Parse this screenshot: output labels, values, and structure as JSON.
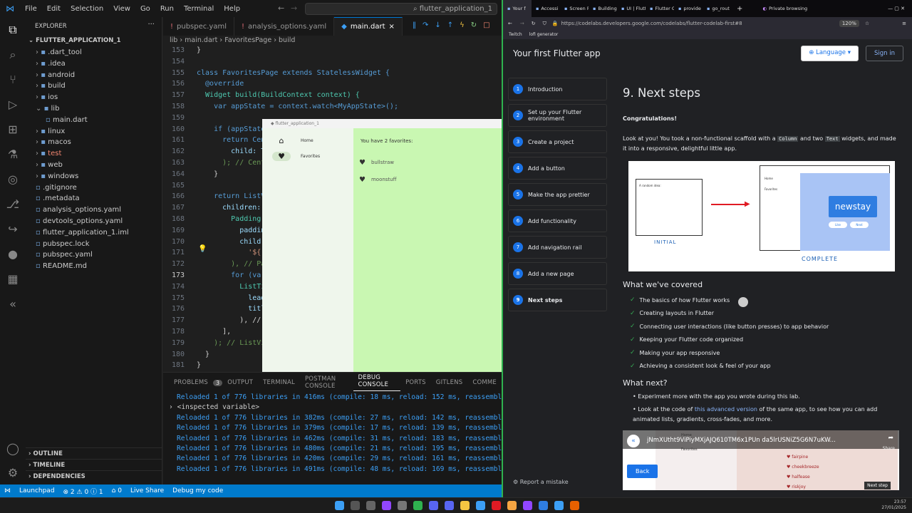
{
  "vscode": {
    "menu": [
      "File",
      "Edit",
      "Selection",
      "View",
      "Go",
      "Run",
      "Terminal",
      "Help"
    ],
    "command_center": "flutter_application_1",
    "explorer_title": "EXPLORER",
    "project": "FLUTTER_APPLICATION_1",
    "tree": [
      {
        "label": ".dart_tool",
        "kind": "folder",
        "depth": 1,
        "color": "#ccc"
      },
      {
        "label": ".idea",
        "kind": "folder",
        "depth": 1,
        "color": "#ccc"
      },
      {
        "label": "android",
        "kind": "folder",
        "depth": 1,
        "color": "#ccc"
      },
      {
        "label": "build",
        "kind": "folder",
        "depth": 1,
        "color": "#ccc"
      },
      {
        "label": "ios",
        "kind": "folder",
        "depth": 1,
        "color": "#ccc"
      },
      {
        "label": "lib",
        "kind": "folder-open",
        "depth": 1,
        "color": "#ccc"
      },
      {
        "label": "main.dart",
        "kind": "file",
        "depth": 2,
        "color": "#ccc"
      },
      {
        "label": "linux",
        "kind": "folder",
        "depth": 1,
        "color": "#ccc"
      },
      {
        "label": "macos",
        "kind": "folder",
        "depth": 1,
        "color": "#ccc"
      },
      {
        "label": "test",
        "kind": "folder",
        "depth": 1,
        "color": "#f48771"
      },
      {
        "label": "web",
        "kind": "folder",
        "depth": 1,
        "color": "#ccc"
      },
      {
        "label": "windows",
        "kind": "folder",
        "depth": 1,
        "color": "#ccc"
      },
      {
        "label": ".gitignore",
        "kind": "file",
        "depth": 1,
        "color": "#ccc"
      },
      {
        "label": ".metadata",
        "kind": "file",
        "depth": 1,
        "color": "#ccc"
      },
      {
        "label": "analysis_options.yaml",
        "kind": "file",
        "depth": 1,
        "color": "#ccc"
      },
      {
        "label": "devtools_options.yaml",
        "kind": "file",
        "depth": 1,
        "color": "#ccc"
      },
      {
        "label": "flutter_application_1.iml",
        "kind": "file",
        "depth": 1,
        "color": "#ccc"
      },
      {
        "label": "pubspec.lock",
        "kind": "file",
        "depth": 1,
        "color": "#ccc"
      },
      {
        "label": "pubspec.yaml",
        "kind": "file",
        "depth": 1,
        "color": "#ccc"
      },
      {
        "label": "README.md",
        "kind": "file",
        "depth": 1,
        "color": "#ccc"
      }
    ],
    "outline_sections": [
      "OUTLINE",
      "TIMELINE",
      "DEPENDENCIES"
    ],
    "tabs": [
      {
        "label": "pubspec.yaml",
        "active": false
      },
      {
        "label": "analysis_options.yaml",
        "active": false
      },
      {
        "label": "main.dart",
        "active": true
      }
    ],
    "breadcrumb": [
      "lib",
      "main.dart",
      "FavoritesPage",
      "build"
    ],
    "line_numbers": [
      "153",
      "154",
      "155",
      "156",
      "157",
      "158",
      "159",
      "160",
      "161",
      "162",
      "163",
      "164",
      "165",
      "166",
      "167",
      "168",
      "169",
      "170",
      "171",
      "172",
      "173",
      "174",
      "175",
      "176",
      "177",
      "178",
      "179",
      "180",
      "181",
      "182",
      "183",
      "184",
      "185"
    ],
    "code_lines": [
      "}",
      "",
      "class FavoritesPage extends StatelessWidget {",
      "  @override",
      "  Widget build(BuildContext context) {",
      "    var appState = context.watch<MyAppState>();",
      "",
      "    if (appState.",
      "      return Cent",
      "        child: Te",
      "      ); // Cent",
      "    }",
      "",
      "    return ListVi",
      "      children: [",
      "        Padding(",
      "          paddin",
      "          child:",
      "            '${",
      "        ), // Pa",
      "        for (var",
      "          ListTi",
      "            lead",
      "            titl",
      "          ), //",
      "      ],",
      "    ); // ListVi",
      "  }",
      "}",
      "",
      "// ...",
      "",
      "class BigCard ext"
    ],
    "panel_tabs": [
      "PROBLEMS",
      "OUTPUT",
      "TERMINAL",
      "POSTMAN CONSOLE",
      "DEBUG CONSOLE",
      "PORTS",
      "GITLENS",
      "COMME"
    ],
    "problems_count": "3",
    "inspected": "<inspected variable>",
    "logs": [
      "Reloaded 1 of 776 libraries in 416ms (compile: 18 ms, reload: 152 ms, reassemble:",
      "Reloaded 1 of 776 libraries in 382ms (compile: 27 ms, reload: 142 ms, reassemble:",
      "Reloaded 1 of 776 libraries in 379ms (compile: 17 ms, reload: 139 ms, reassemble:",
      "Reloaded 1 of 776 libraries in 462ms (compile: 31 ms, reload: 183 ms, reassemble:",
      "Reloaded 1 of 776 libraries in 480ms (compile: 21 ms, reload: 195 ms, reassemble:",
      "Reloaded 1 of 776 libraries in 420ms (compile: 29 ms, reload: 161 ms, reassemble:",
      "Reloaded 1 of 776 libraries in 491ms (compile: 48 ms, reload: 169 ms, reassemble:"
    ],
    "status": {
      "branch": "Launchpad",
      "errors": "⊗ 2 ⚠ 0 ⓘ 1",
      "ports": "⌂ 0",
      "live": "Live Share",
      "debug": "Debug my code"
    }
  },
  "flutter_app": {
    "window_title": "flutter_application_1",
    "nav": [
      {
        "label": "Home",
        "icon": "home-icon"
      },
      {
        "label": "Favorites",
        "icon": "heart-icon",
        "selected": true
      }
    ],
    "summary": "You have 2 favorites:",
    "favorites": [
      "bullstraw",
      "moonstuff"
    ]
  },
  "browser": {
    "tabs": [
      "Your f",
      "Accessi",
      "Screen R",
      "Building",
      "UI | Flutt",
      "Flutter G",
      "provide",
      "go_rout",
      "Private browsing"
    ],
    "url": "https://codelabs.developers.google.com/codelabs/flutter-codelab-first#8",
    "zoom": "120%",
    "bookmarks": [
      "Twitch",
      "lofi generator"
    ]
  },
  "codelab": {
    "title": "Your first Flutter app",
    "language_label": "Language",
    "signin_label": "Sign in",
    "steps": [
      {
        "n": "1",
        "label": "Introduction"
      },
      {
        "n": "2",
        "label": "Set up your Flutter environment"
      },
      {
        "n": "3",
        "label": "Create a project"
      },
      {
        "n": "4",
        "label": "Add a button"
      },
      {
        "n": "5",
        "label": "Make the app prettier"
      },
      {
        "n": "6",
        "label": "Add functionality"
      },
      {
        "n": "7",
        "label": "Add navigation rail"
      },
      {
        "n": "8",
        "label": "Add a new page"
      },
      {
        "n": "9",
        "label": "Next steps",
        "current": true
      }
    ],
    "heading": "9. Next steps",
    "congrats": "Congratulations!",
    "intro_a": "Look at you! You took a non-functional scaffold with a",
    "intro_code1": "Column",
    "intro_b": "and two",
    "intro_code2": "Text",
    "intro_c": "widgets, and made it into a responsive, delightful little app.",
    "illustration": {
      "initial": "INITIAL",
      "complete": "COMPLETE",
      "newstay": "newstay",
      "like": "Like",
      "next": "Next",
      "home": "Home",
      "favorites": "Favorites",
      "small": "A random idea:",
      "small2": "newstay"
    },
    "covered_title": "What we've covered",
    "covered": [
      "The basics of how Flutter works",
      "Creating layouts in Flutter",
      "Connecting user interactions (like button presses) to app behavior",
      "Keeping your Flutter code organized",
      "Making your app responsive",
      "Achieving a consistent look & feel of your app"
    ],
    "next_title": "What next?",
    "next_1": "Experiment more with the app you wrote during this lab.",
    "next_2a": "Look at the code of",
    "next_2link": "this advanced version",
    "next_2b": "of the same app, to see how you can add animated lists, gradients, cross-fades, and more.",
    "video_title": "jNmXUtht9ViPiyMXjAJQ610TM6x1PUn da5lrUSNiZ5G6N7uKW...",
    "video_items": [
      "fairpine",
      "cheekbreeze",
      "halfease",
      "riskjoy"
    ],
    "video_nav": [
      "Home",
      "Favorites"
    ],
    "share": "Share",
    "back_label": "Back",
    "next_step_label": "Next step",
    "report": "Report a mistake"
  },
  "clock": {
    "time": "23:57",
    "date": "27/01/2025"
  }
}
